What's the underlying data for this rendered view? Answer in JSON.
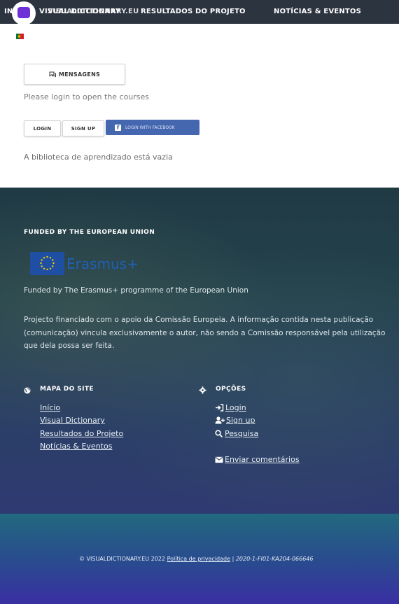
{
  "nav": {
    "items": [
      "INÍCIO",
      "VISUAL DICTIONARY",
      "VISUALDICTIONARY.EU",
      "RESULTADOS DO PROJETO",
      "NOTÍCIAS & EVENTOS"
    ]
  },
  "main": {
    "messages_label": "MENSAGENS",
    "login_note": "Please login to open the courses",
    "login_label": "LOGIN",
    "signup_label": "SIGN UP",
    "facebook_label": "LOGIN WITH FACEBOOK",
    "library_empty": "A biblioteca de aprendizado está vazia"
  },
  "footer": {
    "funded_heading": "FUNDED BY THE EUROPEAN UNION",
    "erasmus_word": "Erasmus+",
    "funded_text": "Funded by The Erasmus+ programme of the European Union",
    "disclaimer_lines": [
      "Projecto financiado com o apoio da Comissão Europeia. A informação contida nesta publicação",
      "(comunicação) vincula exclusivamente o autor, não sendo a Comissão responsável pela utilização",
      "que dela possa ser feita."
    ],
    "sitemap": {
      "heading": "MAPA DO SITE",
      "links": [
        "Início",
        "Visual Dictionary",
        "Resultados do Projeto",
        "Notícias & Eventos"
      ]
    },
    "options": {
      "heading": "OPÇÕES",
      "login": "Login",
      "signup": "Sign up",
      "search": "Pesquisa",
      "feedback": "Enviar comentários"
    },
    "copyright": "© VISUALDICTIONARY.EU 2022",
    "privacy": "Política de privacidade",
    "separator": "|",
    "project_code": "2020-1-FI01-KA204-066646"
  },
  "colors": {
    "nav_bg": "#2c3440",
    "logo_accent": "#6d31d6",
    "facebook_blue": "#4467b0",
    "erasmus_blue": "#1f60b6"
  }
}
